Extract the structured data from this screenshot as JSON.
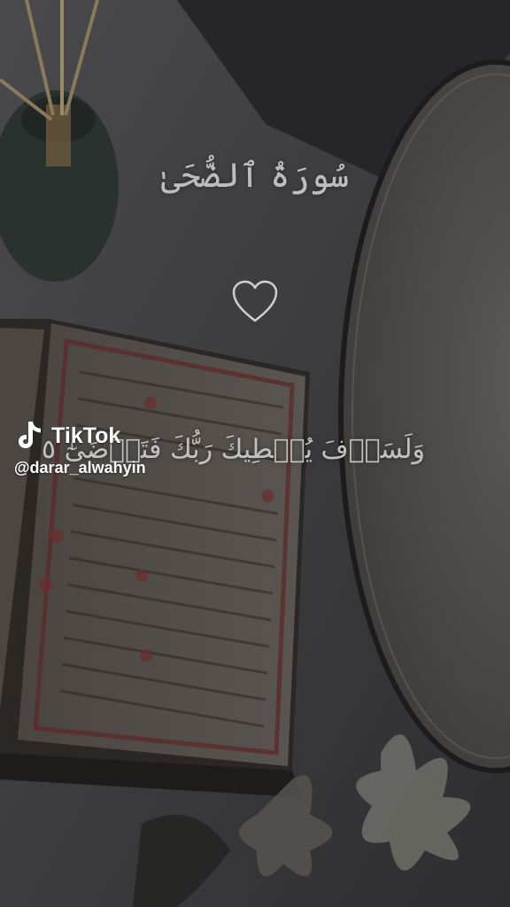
{
  "video": {
    "title_text": "سُورَةُ ٱلضُّحَىٰ",
    "verse_text": "وَلَسَوۡفَ يُعۡطِيكَ رَبُّكَ فَتَرۡضَىٰٓ ٥"
  },
  "watermark": {
    "brand": "TikTok",
    "handle": "@darar_alwahyin"
  },
  "icons": {
    "heart": "heart-outline-icon",
    "tiktok": "tiktok-logo-icon"
  },
  "colors": {
    "overlay_text": "#c2c2c2",
    "watermark_text": "#ffffff"
  }
}
